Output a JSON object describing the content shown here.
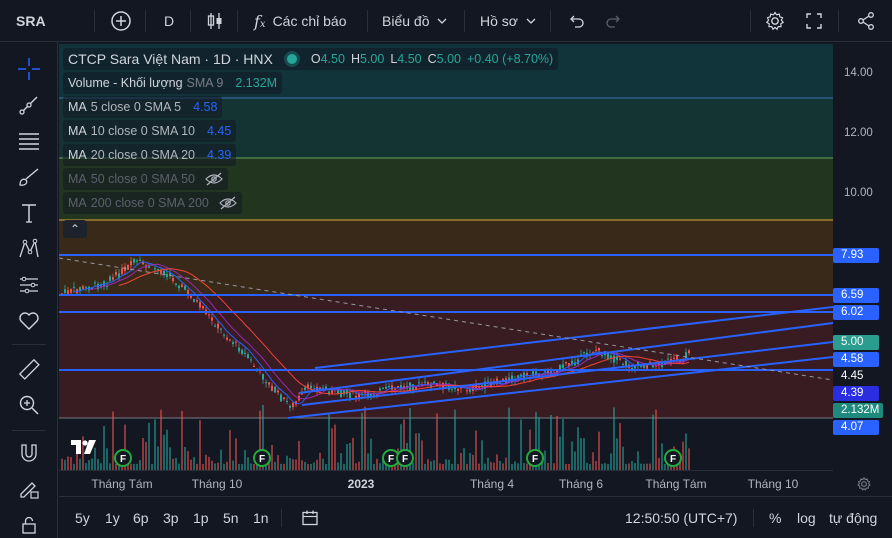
{
  "topbar": {
    "symbol": "SRA",
    "interval": "D",
    "indicators_label": "Các chỉ báo",
    "chart_label": "Biểu đồ",
    "profile_label": "Hồ sơ"
  },
  "legend": {
    "title": "CTCP Sara Việt Nam · 1D · HNX",
    "o_label": "O",
    "o_value": "4.50",
    "h_label": "H",
    "h_value": "5.00",
    "l_label": "L",
    "l_value": "4.50",
    "c_label": "C",
    "c_value": "5.00",
    "change": "+0.40 (+8.70%)",
    "volume_label": "Volume - Khối lượng",
    "volume_sma": "SMA 9",
    "volume_value": "2.132M",
    "ma": [
      {
        "label": "MA",
        "params": "5 close 0 SMA 5",
        "value": "4.58"
      },
      {
        "label": "MA",
        "params": "10 close 0 SMA 10",
        "value": "4.45"
      },
      {
        "label": "MA",
        "params": "20 close 0 SMA 20",
        "value": "4.39"
      },
      {
        "label": "MA",
        "params": "50 close 0 SMA 50",
        "value": ""
      },
      {
        "label": "MA",
        "params": "200 close 0 SMA 200",
        "value": ""
      }
    ],
    "collapse_symbol": "⌃"
  },
  "price_axis": {
    "ticks": [
      "14.00",
      "12.00",
      "10.00"
    ],
    "labels": [
      "7.93",
      "6.59",
      "6.02",
      "5.00",
      "4.58",
      "4.45",
      "4.39",
      "2.132M",
      "4.07"
    ]
  },
  "time_axis": {
    "labels": [
      "Tháng Tám",
      "Tháng 10",
      "2023",
      "Tháng 4",
      "Tháng 6",
      "Tháng Tám",
      "Tháng 10"
    ]
  },
  "bottombar": {
    "ranges": [
      "5y",
      "1y",
      "6p",
      "3p",
      "1p",
      "5n",
      "1n"
    ],
    "clock": "12:50:50 (UTC+7)",
    "percent": "%",
    "log": "log",
    "auto": "tự động"
  },
  "events_marker": "F",
  "colors": {
    "background": "#131722",
    "up": "#26a69a",
    "down": "#ef5350",
    "line_blue": "#2962ff",
    "ma5": "#2962ff",
    "ma10": "#9c27b0",
    "ma20": "#f44336"
  }
}
